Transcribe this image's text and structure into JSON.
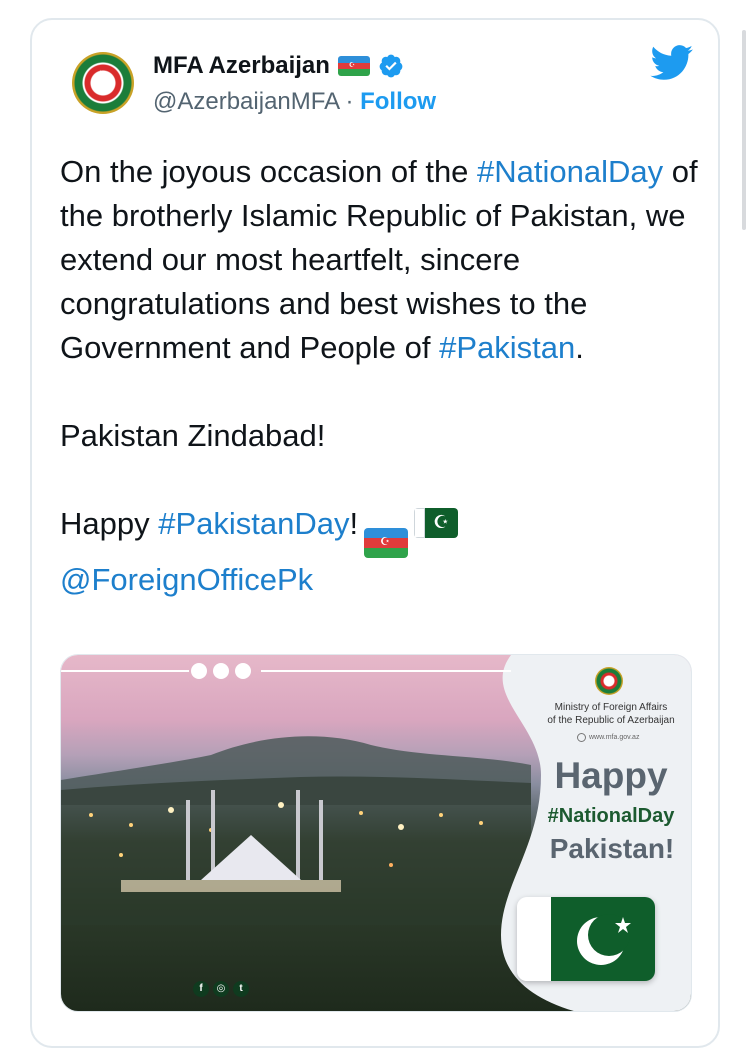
{
  "tweet": {
    "display_name": "MFA Azerbaijan",
    "handle": "@AzerbaijanMFA",
    "separator": " · ",
    "follow_label": "Follow",
    "text": {
      "p1_part1": "On the joyous occasion of the ",
      "p1_tag1": "#NationalDay",
      "p1_part2": " of the brotherly Islamic Republic of Pakistan, we extend our most heartfelt, sincere congratulations and best wishes to the Government and People of ",
      "p1_tag2": "#Pakistan",
      "p1_end": ".",
      "p2": "Pakistan Zindabad!",
      "p3_part1": "Happy ",
      "p3_tag": "#PakistanDay",
      "p3_part2": "!",
      "mention": "@ForeignOfficePk"
    },
    "icons": {
      "avatar": "azerbaijan-emblem-icon",
      "name_flag": "azerbaijan-flag-icon",
      "verified": "verified-badge-icon",
      "brand": "twitter-bird-icon",
      "text_flag_1": "azerbaijan-flag-icon",
      "text_flag_2": "pakistan-flag-icon"
    }
  },
  "media": {
    "ministry_line1": "Ministry of Foreign Affairs",
    "ministry_line2": "of the Republic of Azerbaijan",
    "website": "www.mfa.gov.az",
    "happy": "Happy",
    "national_day": "#NationalDay",
    "pakistan": "Pakistan!",
    "social_icons": [
      "facebook-icon",
      "instagram-icon",
      "twitter-icon"
    ]
  },
  "colors": {
    "link": "#1d7fcc",
    "follow": "#1d9bf0",
    "text": "#0f1419",
    "secondary": "#536471",
    "pakistan_green": "#0f5e2b"
  }
}
